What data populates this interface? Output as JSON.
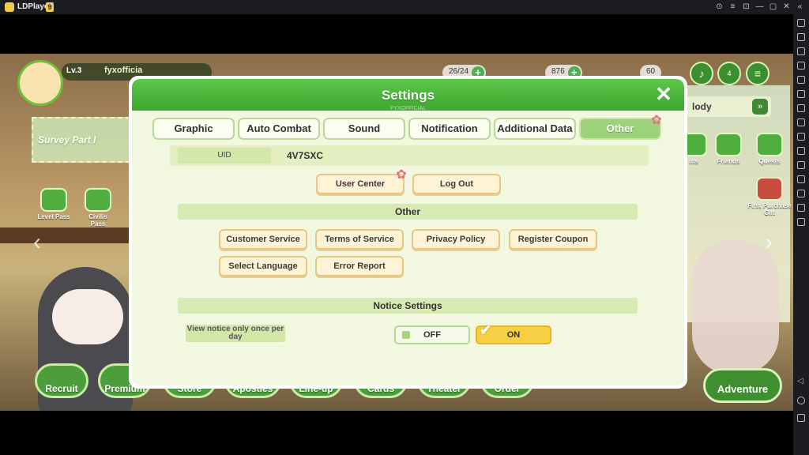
{
  "emulator": {
    "title": "LDPlayer",
    "version": "9",
    "window_buttons": [
      "⊙",
      "≡",
      "⊡",
      "—",
      "▢",
      "✕",
      "«"
    ]
  },
  "hud": {
    "level": "Lv.3",
    "player_name": "fyxofficia",
    "resources": [
      {
        "value": "26/24",
        "icon": "stamina-icon"
      },
      {
        "value": "876",
        "icon": "coin-icon"
      },
      {
        "value": "60",
        "icon": "gem-icon"
      }
    ],
    "mail_badge": "4"
  },
  "background": {
    "survey_banner": "Survey Part I",
    "melody_banner": "lody",
    "side_menu_left": [
      "Level Pass",
      "Civilis Pass"
    ],
    "side_menu_right": [
      "nts",
      "Friends",
      "Quests",
      "First Purchase Gift"
    ],
    "bottom_buttons": [
      "Recruit",
      "Premium",
      "Store",
      "Apostles",
      "Line-up",
      "Cards",
      "Theater",
      "Order"
    ],
    "adventure_button": "Adventure"
  },
  "dialog": {
    "title": "Settings",
    "subtitle": "FYXOFFICIAL",
    "close_icon": "close-icon",
    "tabs": [
      {
        "label": "Graphic",
        "active": false
      },
      {
        "label": "Auto Combat",
        "active": false
      },
      {
        "label": "Sound",
        "active": false
      },
      {
        "label": "Notification",
        "active": false
      },
      {
        "label": "Additional Data",
        "active": false
      },
      {
        "label": "Other",
        "active": true
      }
    ],
    "uid": {
      "label": "UID",
      "value": "4V7SXC"
    },
    "account_buttons": [
      "User Center",
      "Log Out"
    ],
    "other_section": {
      "title": "Other",
      "buttons": [
        "Customer Service",
        "Terms of Service",
        "Privacy Policy",
        "Register Coupon",
        "Select Language",
        "Error Report"
      ]
    },
    "notice_section": {
      "title": "Notice Settings",
      "option_label": "View notice only once per day",
      "off_label": "OFF",
      "on_label": "ON",
      "selected": "ON"
    },
    "colors": {
      "header_green": "#3da72f",
      "panel_bg": "#f2f8df",
      "button_bg": "#fff3d6",
      "toggle_on": "#f7cf45"
    }
  }
}
